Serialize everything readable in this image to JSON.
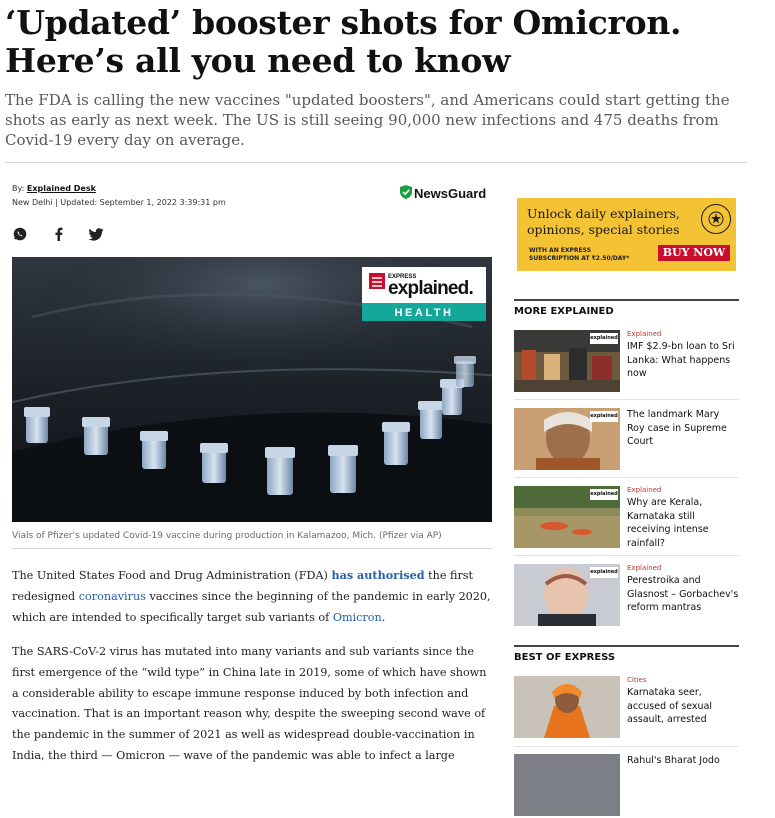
{
  "article": {
    "headline_line1": "‘Updated’ booster shots for Omicron.",
    "headline_line2": "Here’s all you need to know",
    "synopsis": "The FDA is calling the new vaccines \"updated boosters\", and Americans could start getting the shots as early as next week. The US is still seeing 90,000 new infections and 475 deaths from Covid-19 every day on average.",
    "byline_prefix": "By:",
    "author": "Explained Desk",
    "location": "New Delhi",
    "updated": " | Updated: September 1, 2022 3:39:31 pm",
    "hero_badge_top": "EXPRESS",
    "hero_badge_brand": "explained.",
    "hero_badge_section": "HEALTH",
    "caption": "Vials of Pfizer's updated Covid-19 vaccine during production in Kalamazoo, Mich. (Pfizer via AP)",
    "p1_a": "The United States Food and Drug Administration (FDA) ",
    "p1_link1": "has authorised",
    "p1_b": " the first redesigned ",
    "p1_link2": "coronavirus",
    "p1_c": " vaccines since the beginning of the pandemic in early 2020, which are intended to specifically target sub variants of ",
    "p1_link3": "Omicron",
    "p1_d": ".",
    "p2": "The SARS-CoV-2 virus has mutated into many variants and sub variants since the first emergence of the “wild type” in China late in 2019, some of which have shown a considerable ability to escape immune response induced by both infection and vaccination. That is an important reason why, despite the sweeping second wave of the pandemic in the summer of 2021 as well as widespread double-vaccination in India, the third — Omicron — wave of the pandemic was able to infect a large"
  },
  "newsguard": {
    "label": "NewsGuard",
    "icon": "shield-check-icon",
    "color": "#1a9e3f"
  },
  "share": [
    {
      "icon": "whatsapp-icon"
    },
    {
      "icon": "facebook-icon"
    },
    {
      "icon": "twitter-icon"
    }
  ],
  "ad": {
    "line1": "Unlock daily explainers,",
    "line2": "opinions, special stories",
    "small1": "WITH AN EXPRESS",
    "small2": "SUBSCRIPTION AT ₹2.50/DAY*",
    "cta": "BUY NOW",
    "bg": "#f4c235"
  },
  "more_explained": {
    "heading": "MORE EXPLAINED",
    "items": [
      {
        "kicker": "Explained",
        "title": "IMF $2.9-bn loan to Sri Lanka: What happens now"
      },
      {
        "kicker": "",
        "title": "The landmark Mary Roy case in Supreme Court"
      },
      {
        "kicker": "Explained",
        "title": "Why are Kerala, Karnataka still receiving intense rainfall?"
      },
      {
        "kicker": "Explained",
        "title": "Perestroika and Glasnost – Gorbachev's reform mantras"
      }
    ]
  },
  "best_of_express": {
    "heading": "BEST OF EXPRESS",
    "items": [
      {
        "kicker": "Cities",
        "title": "Karnataka seer, accused of sexual assault, arrested"
      },
      {
        "kicker": "",
        "title": "Rahul's Bharat Jodo"
      }
    ]
  },
  "colors": {
    "link": "#245fa8",
    "kicker": "#c0392b",
    "brand_red": "#c8102e",
    "health_teal": "#14a89a"
  }
}
